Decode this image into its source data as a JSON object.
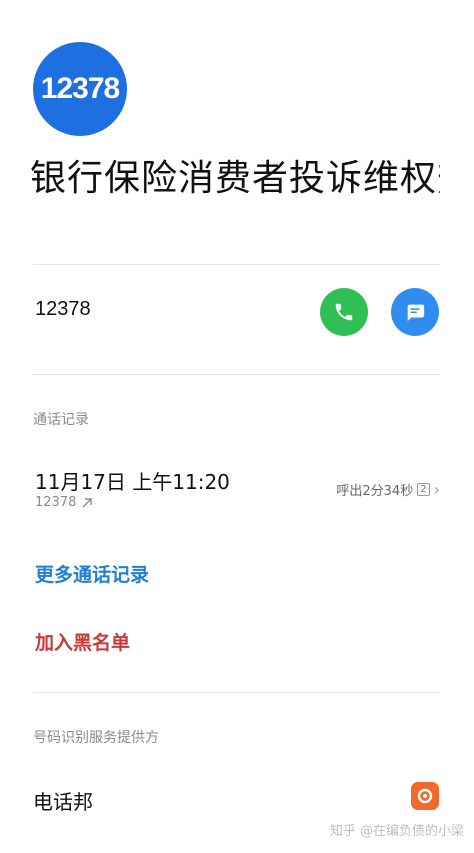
{
  "contact": {
    "avatar_text": "12378",
    "name": "银行保险消费者投诉维权热线",
    "number": "12378",
    "avatar_color": "#1e6fe0"
  },
  "actions": {
    "call_icon": "phone-icon",
    "message_icon": "message-icon"
  },
  "call_log": {
    "section_label": "通话记录",
    "entries": [
      {
        "datetime": "11月17日 上午11:20",
        "number": "12378",
        "direction_icon": "outgoing-arrow-icon",
        "status": "呼出2分34秒",
        "sim": "2"
      }
    ],
    "more_label": "更多通话记录"
  },
  "blacklist_label": "加入黑名单",
  "provider": {
    "section_label": "号码识别服务提供方",
    "name": "电话邦",
    "logo_color": "#f26a2b"
  },
  "watermark": "知乎 @在编负债的小梁"
}
